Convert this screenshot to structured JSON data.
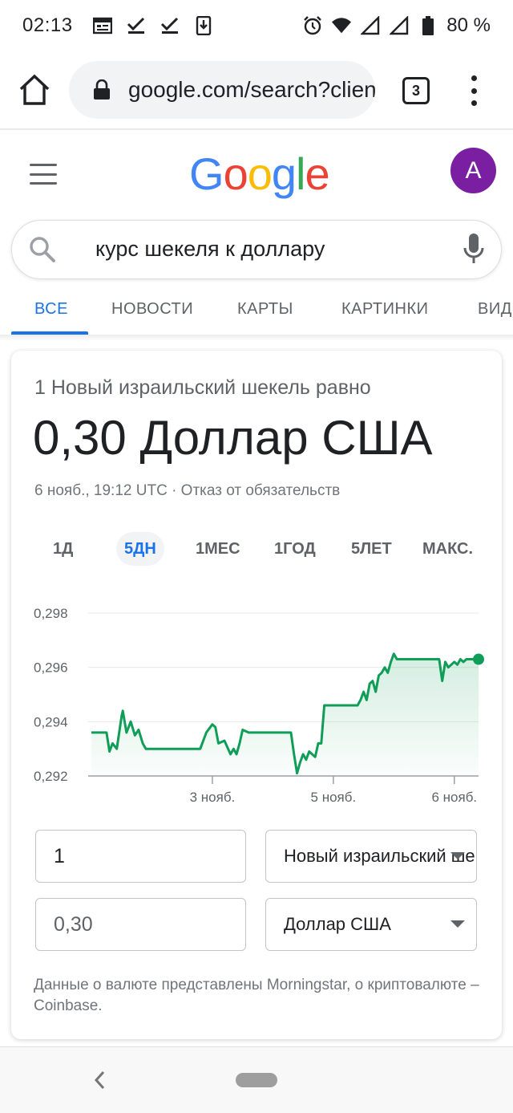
{
  "status_bar": {
    "time": "02:13",
    "battery": "80 %",
    "left_icons": [
      "calendar-icon",
      "check-icon",
      "check-icon",
      "download-icon"
    ],
    "right_icons": [
      "alarm-icon",
      "wifi-icon",
      "signal-icon",
      "signal-icon",
      "battery-icon"
    ]
  },
  "browser": {
    "url": "google.com/search?client",
    "tab_count": "3"
  },
  "google": {
    "logo": [
      "G",
      "o",
      "o",
      "g",
      "l",
      "e"
    ],
    "logo_colors": [
      "#4285F4",
      "#EA4335",
      "#FBBC05",
      "#4285F4",
      "#34A853",
      "#EA4335"
    ],
    "avatar_letter": "A",
    "avatar_color": "#7b1fa2"
  },
  "search": {
    "query": "курс шекеля к доллару"
  },
  "tabs": [
    {
      "label": "ВСЕ",
      "active": true
    },
    {
      "label": "НОВОСТИ",
      "active": false
    },
    {
      "label": "КАРТЫ",
      "active": false
    },
    {
      "label": "КАРТИНКИ",
      "active": false
    },
    {
      "label": "ВИД",
      "active": false
    }
  ],
  "converter": {
    "from_line": "1 Новый израильский шекель равно",
    "result": "0,30 Доллар США",
    "meta": "6 нояб., 19:12 UTC · Отказ от обязательств",
    "ranges": [
      {
        "label": "1Д",
        "active": false
      },
      {
        "label": "5ДН",
        "active": true
      },
      {
        "label": "1МЕС",
        "active": false
      },
      {
        "label": "1ГОД",
        "active": false
      },
      {
        "label": "5ЛЕТ",
        "active": false
      },
      {
        "label": "МАКС.",
        "active": false
      }
    ],
    "from_amount": "1",
    "from_currency": "Новый израильский шекель",
    "to_amount": "0,30",
    "to_currency": "Доллар США",
    "source_note": "Данные о валюте представлены Morningstar, о криптовалюте – Coinbase."
  },
  "chart_data": {
    "type": "line",
    "ylim": [
      0.292,
      0.298
    ],
    "yticks": [
      "0,298",
      "0,296",
      "0,294",
      "0,292"
    ],
    "ytick_values": [
      0.298,
      0.296,
      0.294,
      0.292
    ],
    "xticks": [
      "3 нояб.",
      "5 нояб.",
      "6 нояб."
    ],
    "xtick_positions": [
      2,
      4,
      6
    ],
    "xlim": [
      0,
      6.4
    ],
    "line_color": "#0f9d58",
    "x": [
      0,
      0.25,
      0.3,
      0.35,
      0.42,
      0.5,
      0.52,
      0.58,
      0.65,
      0.72,
      0.78,
      0.85,
      0.9,
      1.0,
      1.05,
      1.2,
      1.5,
      1.8,
      1.9,
      2.0,
      2.05,
      2.1,
      2.2,
      2.3,
      2.35,
      2.4,
      2.45,
      2.5,
      2.6,
      2.7,
      2.8,
      3.0,
      3.2,
      3.3,
      3.35,
      3.4,
      3.45,
      3.5,
      3.55,
      3.6,
      3.7,
      3.75,
      3.8,
      3.85,
      3.9,
      4.0,
      4.2,
      4.4,
      4.45,
      4.5,
      4.55,
      4.6,
      4.65,
      4.7,
      4.75,
      4.8,
      4.85,
      4.9,
      4.95,
      5.0,
      5.05,
      5.1,
      5.2,
      5.4,
      5.6,
      5.75,
      5.8,
      5.85,
      5.9,
      5.95,
      6.0,
      6.05,
      6.1,
      6.15,
      6.2,
      6.25,
      6.3,
      6.4
    ],
    "y": [
      0.2936,
      0.2936,
      0.2929,
      0.2932,
      0.293,
      0.2942,
      0.2944,
      0.2936,
      0.294,
      0.2935,
      0.2937,
      0.2932,
      0.293,
      0.293,
      0.293,
      0.293,
      0.293,
      0.293,
      0.2936,
      0.2939,
      0.2938,
      0.2932,
      0.2933,
      0.2928,
      0.293,
      0.2928,
      0.2932,
      0.2937,
      0.2936,
      0.2936,
      0.2936,
      0.2936,
      0.2936,
      0.2936,
      0.2928,
      0.2921,
      0.2925,
      0.2928,
      0.2926,
      0.2929,
      0.2927,
      0.2932,
      0.2932,
      0.2946,
      0.2946,
      0.2946,
      0.2946,
      0.2946,
      0.2948,
      0.2951,
      0.2948,
      0.2954,
      0.2955,
      0.2951,
      0.2957,
      0.2958,
      0.296,
      0.2958,
      0.2962,
      0.2965,
      0.2963,
      0.2963,
      0.2963,
      0.2963,
      0.2963,
      0.2963,
      0.2955,
      0.2962,
      0.296,
      0.2961,
      0.2962,
      0.2961,
      0.2963,
      0.2962,
      0.2963,
      0.2963,
      0.2963,
      0.2963
    ]
  }
}
